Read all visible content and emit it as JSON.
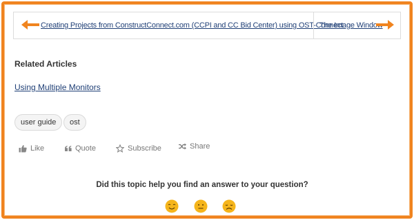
{
  "navigation": {
    "previous_label": "Creating Projects from ConstructConnect.com (CCPI and CC Bid Center) using OST-Connect",
    "next_label": "The Image Window",
    "arrow_color": "#f0841f",
    "arrow_icon": "arrow-icon"
  },
  "related": {
    "heading": "Related Articles",
    "links": [
      "Using Multiple Monitors"
    ]
  },
  "tags": [
    "user guide",
    "ost"
  ],
  "actions": {
    "like": "Like",
    "quote": "Quote",
    "subscribe": "Subscribe",
    "share": "Share"
  },
  "feedback": {
    "question": "Did this topic help you find an answer to your question?",
    "options": [
      "happy-face",
      "neutral-face",
      "sad-face"
    ],
    "face_color": "#f5b51c"
  },
  "theme": {
    "frame_color": "#f0841f",
    "link_color": "#1f3f76"
  }
}
